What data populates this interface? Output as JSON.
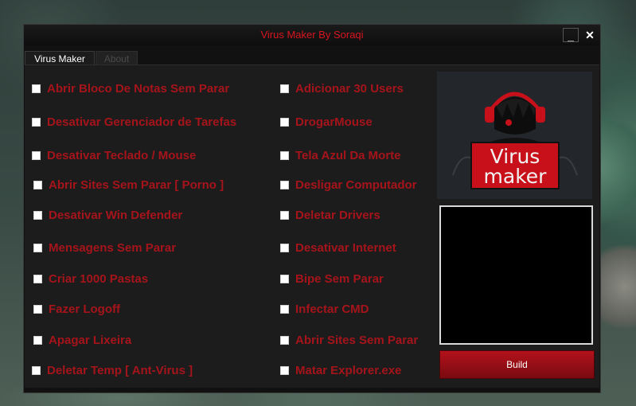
{
  "window": {
    "title": "Virus Maker By Soraqi",
    "minimize_glyph": "_",
    "close_glyph": "✕"
  },
  "tabs": [
    {
      "label": "Virus Maker",
      "active": true
    },
    {
      "label": "About",
      "active": false
    }
  ],
  "options_left": [
    "Abrir Bloco De Notas Sem Parar",
    "Desativar Gerenciador de Tarefas",
    "Desativar Teclado / Mouse",
    "Abrir Sites Sem Parar [ Porno ]",
    "Desativar Win Defender",
    "Mensagens Sem Parar",
    "Criar 1000 Pastas",
    "Fazer Logoff",
    "Apagar Lixeira",
    "Deletar Temp [ Ant-Virus ]"
  ],
  "options_right": [
    "Adicionar 30 Users",
    "DrogarMouse",
    "Tela Azul Da Morte",
    "Desligar Computador",
    "Deletar Drivers",
    "Desativar Internet",
    "Bipe Sem Parar",
    "Infectar CMD",
    "Abrir Sites Sem Parar",
    "Matar Explorer.exe"
  ],
  "logo": {
    "line1": "Virus",
    "line2": "maker",
    "icon": "hooded-figure-headphones-icon"
  },
  "build_button": "Build",
  "colors": {
    "accent": "#d8151f",
    "option_text": "#a6141b",
    "window_bg": "#1c1c1c",
    "button": "#9e1017"
  }
}
